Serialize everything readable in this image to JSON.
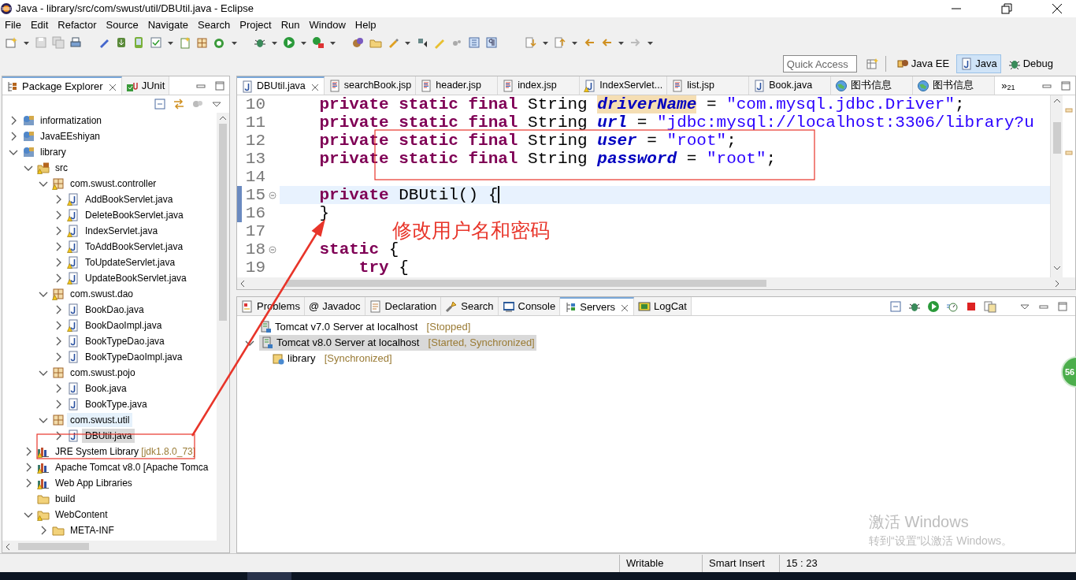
{
  "window": {
    "title": "Java - library/src/com/swust/util/DBUtil.java - Eclipse"
  },
  "menu": [
    "File",
    "Edit",
    "Refactor",
    "Source",
    "Navigate",
    "Search",
    "Project",
    "Run",
    "Window",
    "Help"
  ],
  "quick_access": {
    "placeholder": "Quick Access"
  },
  "perspectives": [
    {
      "label": "Java EE",
      "kind": "javaee",
      "selected": false
    },
    {
      "label": "Java",
      "kind": "java",
      "selected": true
    },
    {
      "label": "Debug",
      "kind": "debug",
      "selected": false
    }
  ],
  "package_explorer": {
    "tabs": [
      {
        "label": "Package Explorer",
        "kind": "explorer",
        "selected": true,
        "closable": true
      },
      {
        "label": "JUnit",
        "kind": "junit",
        "selected": false,
        "closable": false
      }
    ],
    "tree": [
      {
        "label": "informatization",
        "kind": "project",
        "warning": false,
        "expanded": false,
        "selected": false,
        "hovered": false
      },
      {
        "label": "JavaEEshiyan",
        "kind": "project",
        "warning": false,
        "expanded": false,
        "selected": false,
        "hovered": false
      },
      {
        "label": "library",
        "kind": "project",
        "warning": false,
        "expanded": true,
        "selected": false,
        "hovered": false,
        "children": [
          {
            "label": "src",
            "kind": "srcfolder",
            "warning": true,
            "expanded": true,
            "selected": false,
            "hovered": false,
            "children": [
              {
                "label": "com.swust.controller",
                "kind": "package",
                "warning": true,
                "expanded": true,
                "selected": false,
                "hovered": false,
                "children": [
                  {
                    "label": "AddBookServlet.java",
                    "kind": "java",
                    "warning": true,
                    "expanded": false,
                    "selected": false,
                    "hovered": false
                  },
                  {
                    "label": "DeleteBookServlet.java",
                    "kind": "java",
                    "warning": true,
                    "expanded": false,
                    "selected": false,
                    "hovered": false
                  },
                  {
                    "label": "IndexServlet.java",
                    "kind": "java",
                    "warning": true,
                    "expanded": false,
                    "selected": false,
                    "hovered": false
                  },
                  {
                    "label": "ToAddBookServlet.java",
                    "kind": "java",
                    "warning": true,
                    "expanded": false,
                    "selected": false,
                    "hovered": false
                  },
                  {
                    "label": "ToUpdateServlet.java",
                    "kind": "java",
                    "warning": true,
                    "expanded": false,
                    "selected": false,
                    "hovered": false
                  },
                  {
                    "label": "UpdateBookServlet.java",
                    "kind": "java",
                    "warning": true,
                    "expanded": false,
                    "selected": false,
                    "hovered": false
                  }
                ]
              },
              {
                "label": "com.swust.dao",
                "kind": "package",
                "warning": true,
                "expanded": true,
                "selected": false,
                "hovered": false,
                "children": [
                  {
                    "label": "BookDao.java",
                    "kind": "java",
                    "warning": false,
                    "expanded": false,
                    "selected": false,
                    "hovered": false
                  },
                  {
                    "label": "BookDaoImpl.java",
                    "kind": "java",
                    "warning": true,
                    "expanded": false,
                    "selected": false,
                    "hovered": false
                  },
                  {
                    "label": "BookTypeDao.java",
                    "kind": "java",
                    "warning": false,
                    "expanded": false,
                    "selected": false,
                    "hovered": false
                  },
                  {
                    "label": "BookTypeDaoImpl.java",
                    "kind": "java",
                    "warning": false,
                    "expanded": false,
                    "selected": false,
                    "hovered": false
                  }
                ]
              },
              {
                "label": "com.swust.pojo",
                "kind": "package",
                "warning": false,
                "expanded": true,
                "selected": false,
                "hovered": false,
                "children": [
                  {
                    "label": "Book.java",
                    "kind": "java",
                    "warning": false,
                    "expanded": false,
                    "selected": false,
                    "hovered": false
                  },
                  {
                    "label": "BookType.java",
                    "kind": "java",
                    "warning": false,
                    "expanded": false,
                    "selected": false,
                    "hovered": false
                  }
                ]
              },
              {
                "label": "com.swust.util",
                "kind": "package",
                "warning": false,
                "expanded": true,
                "selected": false,
                "hovered": true,
                "children": [
                  {
                    "label": "DBUtil.java",
                    "kind": "java",
                    "warning": false,
                    "expanded": false,
                    "selected": true,
                    "hovered": false
                  }
                ]
              }
            ]
          },
          {
            "label": "JRE System Library",
            "decoration": "[jdk1.8.0_73]",
            "kind": "library",
            "warning": true,
            "expanded": false,
            "selected": false,
            "hovered": false
          },
          {
            "label": "Apache Tomcat v8.0 [Apache Tomca",
            "kind": "library",
            "warning": true,
            "expanded": false,
            "selected": false,
            "hovered": false
          },
          {
            "label": "Web App Libraries",
            "kind": "library",
            "warning": true,
            "expanded": false,
            "selected": false,
            "hovered": false
          },
          {
            "label": "build",
            "kind": "folder",
            "warning": false,
            "selected": false,
            "hovered": false
          },
          {
            "label": "WebContent",
            "kind": "folder",
            "warning": true,
            "expanded": true,
            "selected": false,
            "hovered": false,
            "children": [
              {
                "label": "META-INF",
                "kind": "folder",
                "warning": false,
                "expanded": false,
                "selected": false,
                "hovered": false
              }
            ]
          }
        ]
      }
    ]
  },
  "editor": {
    "tabs": [
      {
        "label": "DBUtil.java",
        "kind": "java",
        "warning": false,
        "selected": true
      },
      {
        "label": "searchBook.jsp",
        "kind": "jsp",
        "warning": false,
        "selected": false
      },
      {
        "label": "header.jsp",
        "kind": "jsp",
        "warning": false,
        "selected": false
      },
      {
        "label": "index.jsp",
        "kind": "jsp",
        "warning": false,
        "selected": false
      },
      {
        "label": "IndexServlet...",
        "kind": "java",
        "warning": true,
        "selected": false
      },
      {
        "label": "list.jsp",
        "kind": "jsp",
        "warning": false,
        "selected": false
      },
      {
        "label": "Book.java",
        "kind": "java",
        "warning": false,
        "selected": false
      },
      {
        "label": "图书信息",
        "kind": "web",
        "warning": false,
        "selected": false
      },
      {
        "label": "图书信息",
        "kind": "web",
        "warning": false,
        "selected": false
      }
    ],
    "overflow": {
      "glyph": "»",
      "count": "21"
    },
    "lines": [
      {
        "number": "10",
        "kind": "member",
        "fold": false,
        "current": false,
        "tokens": [
          {
            "kind": "keyword",
            "text": "private static final"
          },
          {
            "kind": "plain",
            "text": " String "
          },
          {
            "kind": "occurrence",
            "text": "driverName"
          },
          {
            "kind": "plain",
            "text": " = "
          },
          {
            "kind": "string",
            "text": "\"com.mysql.jdbc.Driver\""
          },
          {
            "kind": "plain",
            "text": ";"
          }
        ]
      },
      {
        "number": "11",
        "kind": "member",
        "fold": false,
        "current": false,
        "tokens": [
          {
            "kind": "keyword",
            "text": "private static final"
          },
          {
            "kind": "plain",
            "text": " String "
          },
          {
            "kind": "field",
            "text": "url"
          },
          {
            "kind": "plain",
            "text": " = "
          },
          {
            "kind": "string",
            "text": "\"jdbc:mysql://localhost:3306/library?u"
          }
        ]
      },
      {
        "number": "12",
        "kind": "member",
        "fold": false,
        "current": false,
        "tokens": [
          {
            "kind": "keyword",
            "text": "private static final"
          },
          {
            "kind": "plain",
            "text": " String "
          },
          {
            "kind": "field",
            "text": "user"
          },
          {
            "kind": "plain",
            "text": " = "
          },
          {
            "kind": "string",
            "text": "\"root\""
          },
          {
            "kind": "plain",
            "text": ";"
          }
        ]
      },
      {
        "number": "13",
        "kind": "member",
        "fold": false,
        "current": false,
        "tokens": [
          {
            "kind": "keyword",
            "text": "private static final"
          },
          {
            "kind": "plain",
            "text": " String "
          },
          {
            "kind": "field",
            "text": "password"
          },
          {
            "kind": "plain",
            "text": " = "
          },
          {
            "kind": "string",
            "text": "\"root\""
          },
          {
            "kind": "plain",
            "text": ";"
          }
        ]
      },
      {
        "number": "14",
        "kind": "blank",
        "fold": false,
        "current": false
      },
      {
        "number": "15",
        "kind": "member",
        "fold": true,
        "current": true,
        "tokens": [
          {
            "kind": "keyword",
            "text": "private"
          },
          {
            "kind": "plain",
            "text": " DBUtil() {"
          }
        ]
      },
      {
        "number": "16",
        "kind": "member",
        "fold": false,
        "current": false,
        "tokens": [
          {
            "kind": "plain",
            "text": "}"
          }
        ]
      },
      {
        "number": "17",
        "kind": "blank",
        "fold": false,
        "current": false
      },
      {
        "number": "18",
        "kind": "member",
        "fold": true,
        "current": false,
        "tokens": [
          {
            "kind": "keyword",
            "text": "static"
          },
          {
            "kind": "plain",
            "text": " {"
          }
        ]
      },
      {
        "number": "19",
        "kind": "statement",
        "fold": false,
        "current": false,
        "tokens": [
          {
            "kind": "keyword",
            "text": "try"
          },
          {
            "kind": "plain",
            "text": " {"
          }
        ]
      }
    ]
  },
  "bottom_panel": {
    "tabs": [
      {
        "label": "Problems",
        "kind": "problems",
        "selected": false
      },
      {
        "label": "Javadoc",
        "kind": "glyph",
        "glyph": "@",
        "selected": false
      },
      {
        "label": "Declaration",
        "kind": "declaration",
        "selected": false
      },
      {
        "label": "Search",
        "kind": "search",
        "selected": false
      },
      {
        "label": "Console",
        "kind": "console",
        "selected": false
      },
      {
        "label": "Servers",
        "kind": "servers",
        "selected": true
      },
      {
        "label": "LogCat",
        "kind": "logcat",
        "selected": false
      }
    ],
    "servers": [
      {
        "label": "Tomcat v7.0 Server at localhost",
        "state": "[Stopped]",
        "selected": false
      },
      {
        "label": "Tomcat v8.0 Server at localhost",
        "state": "[Started, Synchronized]",
        "expanded": true,
        "selected": true,
        "children": [
          {
            "label": "library",
            "state": "[Synchronized]",
            "selected": false
          }
        ]
      }
    ]
  },
  "status_bar": [
    "Writable",
    "Smart Insert",
    "15 : 23"
  ],
  "annotation": {
    "note": "修改用户名和密码"
  },
  "activation": {
    "title": "激活 Windows",
    "hint": "转到“设置”以激活 Windows。"
  },
  "side_badge": "56"
}
